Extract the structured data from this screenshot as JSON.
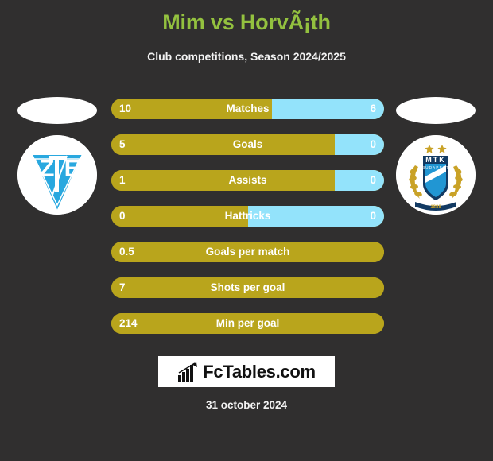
{
  "header": {
    "title": "Mim vs HorvÃ¡th",
    "subtitle": "Club competitions, Season 2024/2025",
    "title_color": "#93c13f"
  },
  "teams": {
    "home": {
      "badge": "zte-crest-icon",
      "name": "ZTE"
    },
    "away": {
      "badge": "mtk-budapest-crest-icon",
      "name": "MTK BUDAPEST",
      "founded": "1888"
    }
  },
  "colors": {
    "background": "#302f2f",
    "home_bar": "#b9a51c",
    "away_bar": "#93e3fb",
    "accent_green": "#93c13f",
    "text": "#ffffff"
  },
  "chart_data": {
    "type": "bar",
    "title": "Mim vs HorvÃ¡th",
    "subtitle": "Club competitions, Season 2024/2025",
    "orientation": "horizontal-diverging",
    "series": [
      {
        "name": "Mim",
        "color": "#b9a51c"
      },
      {
        "name": "HorvÃ¡th",
        "color": "#93e3fb"
      }
    ],
    "categories": [
      "Matches",
      "Goals",
      "Assists",
      "Hattricks",
      "Goals per match",
      "Shots per goal",
      "Min per goal"
    ],
    "rows": [
      {
        "label": "Matches",
        "home": "10",
        "away": "6",
        "home_pct": 59,
        "two_sided": true
      },
      {
        "label": "Goals",
        "home": "5",
        "away": "0",
        "home_pct": 82,
        "two_sided": true
      },
      {
        "label": "Assists",
        "home": "1",
        "away": "0",
        "home_pct": 82,
        "two_sided": true
      },
      {
        "label": "Hattricks",
        "home": "0",
        "away": "0",
        "home_pct": 50,
        "two_sided": true
      },
      {
        "label": "Goals per match",
        "home": "0.5",
        "away": "",
        "home_pct": 100,
        "two_sided": false
      },
      {
        "label": "Shots per goal",
        "home": "7",
        "away": "",
        "home_pct": 100,
        "two_sided": false
      },
      {
        "label": "Min per goal",
        "home": "214",
        "away": "",
        "home_pct": 100,
        "two_sided": false
      }
    ]
  },
  "footer": {
    "logo_text": "FcTables.com",
    "logo_icon": "bar-chart-arrow-icon",
    "date": "31 october 2024"
  }
}
